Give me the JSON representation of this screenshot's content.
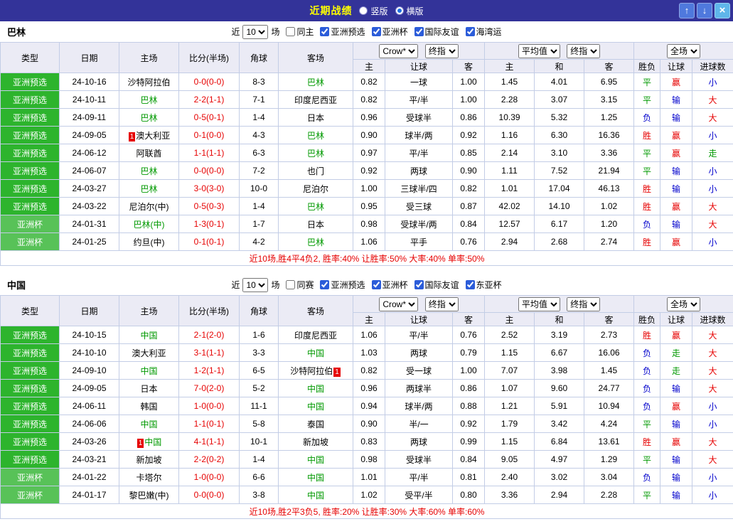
{
  "titlebar": {
    "title": "近期战绩",
    "vertical": "竖版",
    "horizontal": "横版",
    "selected": "横版",
    "up": "↑",
    "down": "↓",
    "close": "×"
  },
  "labels": {
    "near": "近",
    "games": "场"
  },
  "colors": {
    "titlebar_bg": "#333399",
    "title_text": "#ffff00",
    "badge_preliminary": "#2db42d",
    "badge_cup": "#58c25b",
    "win_red": "#e60000",
    "draw_green": "#009900",
    "lose_blue": "#0000cc",
    "focus_team_green": "#009900"
  },
  "head": {
    "type": "类型",
    "date": "日期",
    "home": "主场",
    "score": "比分(半场)",
    "corner": "角球",
    "away": "客场",
    "book": "Crow*",
    "final": "终指",
    "avg": "平均值",
    "scope": "全场",
    "sub": [
      "主",
      "让球",
      "客",
      "主",
      "和",
      "客",
      "胜负",
      "让球",
      "进球数"
    ]
  },
  "sections": [
    {
      "team": "巴林",
      "filter": {
        "count": "10",
        "same_label": "同主",
        "same_checked": false,
        "comps": [
          "亚洲预选",
          "亚洲杯",
          "国际友谊",
          "海湾运"
        ]
      },
      "rows": [
        {
          "type": "亚洲预选",
          "date": "24-10-16",
          "home": "沙特阿拉伯",
          "home_focus": false,
          "score": "0-0(0-0)",
          "corner": "8-3",
          "away": "巴林",
          "away_focus": true,
          "odds": [
            "0.82",
            "一球",
            "1.00"
          ],
          "avg": [
            "1.45",
            "4.01",
            "6.95"
          ],
          "results": [
            "平",
            "赢",
            "小"
          ]
        },
        {
          "type": "亚洲预选",
          "date": "24-10-11",
          "home": "巴林",
          "home_focus": true,
          "score": "2-2(1-1)",
          "corner": "7-1",
          "away": "印度尼西亚",
          "away_focus": false,
          "odds": [
            "0.82",
            "平/半",
            "1.00"
          ],
          "avg": [
            "2.28",
            "3.07",
            "3.15"
          ],
          "results": [
            "平",
            "输",
            "大"
          ]
        },
        {
          "type": "亚洲预选",
          "date": "24-09-11",
          "home": "巴林",
          "home_focus": true,
          "score": "0-5(0-1)",
          "corner": "1-4",
          "away": "日本",
          "away_focus": false,
          "odds": [
            "0.96",
            "受球半",
            "0.86"
          ],
          "avg": [
            "10.39",
            "5.32",
            "1.25"
          ],
          "results": [
            "负",
            "输",
            "大"
          ]
        },
        {
          "type": "亚洲预选",
          "date": "24-09-05",
          "home": "澳大利亚",
          "home_focus": false,
          "home_mark": "1",
          "home_mark_pos": "before",
          "score": "0-1(0-0)",
          "corner": "4-3",
          "away": "巴林",
          "away_focus": true,
          "odds": [
            "0.90",
            "球半/两",
            "0.92"
          ],
          "avg": [
            "1.16",
            "6.30",
            "16.36"
          ],
          "results": [
            "胜",
            "赢",
            "小"
          ]
        },
        {
          "type": "亚洲预选",
          "date": "24-06-12",
          "home": "阿联酋",
          "home_focus": false,
          "score": "1-1(1-1)",
          "corner": "6-3",
          "away": "巴林",
          "away_focus": true,
          "odds": [
            "0.97",
            "平/半",
            "0.85"
          ],
          "avg": [
            "2.14",
            "3.10",
            "3.36"
          ],
          "results": [
            "平",
            "赢",
            "走"
          ]
        },
        {
          "type": "亚洲预选",
          "date": "24-06-07",
          "home": "巴林",
          "home_focus": true,
          "score": "0-0(0-0)",
          "corner": "7-2",
          "away": "也门",
          "away_focus": false,
          "odds": [
            "0.92",
            "两球",
            "0.90"
          ],
          "avg": [
            "1.11",
            "7.52",
            "21.94"
          ],
          "results": [
            "平",
            "输",
            "小"
          ]
        },
        {
          "type": "亚洲预选",
          "date": "24-03-27",
          "home": "巴林",
          "home_focus": true,
          "score": "3-0(3-0)",
          "corner": "10-0",
          "away": "尼泊尔",
          "away_focus": false,
          "odds": [
            "1.00",
            "三球半/四",
            "0.82"
          ],
          "avg": [
            "1.01",
            "17.04",
            "46.13"
          ],
          "results": [
            "胜",
            "输",
            "小"
          ]
        },
        {
          "type": "亚洲预选",
          "date": "24-03-22",
          "home": "尼泊尔(中)",
          "home_focus": false,
          "score": "0-5(0-3)",
          "corner": "1-4",
          "away": "巴林",
          "away_focus": true,
          "odds": [
            "0.95",
            "受三球",
            "0.87"
          ],
          "avg": [
            "42.02",
            "14.10",
            "1.02"
          ],
          "results": [
            "胜",
            "赢",
            "大"
          ]
        },
        {
          "type": "亚洲杯",
          "date": "24-01-31",
          "home": "巴林(中)",
          "home_focus": true,
          "score": "1-3(0-1)",
          "corner": "1-7",
          "away": "日本",
          "away_focus": false,
          "odds": [
            "0.98",
            "受球半/两",
            "0.84"
          ],
          "avg": [
            "12.57",
            "6.17",
            "1.20"
          ],
          "results": [
            "负",
            "输",
            "大"
          ]
        },
        {
          "type": "亚洲杯",
          "date": "24-01-25",
          "home": "约旦(中)",
          "home_focus": false,
          "score": "0-1(0-1)",
          "corner": "4-2",
          "away": "巴林",
          "away_focus": true,
          "odds": [
            "1.06",
            "平手",
            "0.76"
          ],
          "avg": [
            "2.94",
            "2.68",
            "2.74"
          ],
          "results": [
            "胜",
            "赢",
            "小"
          ]
        }
      ],
      "summary": "近10场,胜4平4负2, 胜率:40% 让胜率:50% 大率:40% 单率:50%"
    },
    {
      "team": "中国",
      "filter": {
        "count": "10",
        "same_label": "同赛",
        "same_checked": false,
        "comps": [
          "亚洲预选",
          "亚洲杯",
          "国际友谊",
          "东亚杯"
        ]
      },
      "rows": [
        {
          "type": "亚洲预选",
          "date": "24-10-15",
          "home": "中国",
          "home_focus": true,
          "score": "2-1(2-0)",
          "corner": "1-6",
          "away": "印度尼西亚",
          "away_focus": false,
          "odds": [
            "1.06",
            "平/半",
            "0.76"
          ],
          "avg": [
            "2.52",
            "3.19",
            "2.73"
          ],
          "results": [
            "胜",
            "赢",
            "大"
          ]
        },
        {
          "type": "亚洲预选",
          "date": "24-10-10",
          "home": "澳大利亚",
          "home_focus": false,
          "score": "3-1(1-1)",
          "corner": "3-3",
          "away": "中国",
          "away_focus": true,
          "odds": [
            "1.03",
            "两球",
            "0.79"
          ],
          "avg": [
            "1.15",
            "6.67",
            "16.06"
          ],
          "results": [
            "负",
            "走",
            "大"
          ]
        },
        {
          "type": "亚洲预选",
          "date": "24-09-10",
          "home": "中国",
          "home_focus": true,
          "score": "1-2(1-1)",
          "corner": "6-5",
          "away": "沙特阿拉伯",
          "away_focus": false,
          "away_mark": "1",
          "away_mark_pos": "after",
          "odds": [
            "0.82",
            "受一球",
            "1.00"
          ],
          "avg": [
            "7.07",
            "3.98",
            "1.45"
          ],
          "results": [
            "负",
            "走",
            "大"
          ]
        },
        {
          "type": "亚洲预选",
          "date": "24-09-05",
          "home": "日本",
          "home_focus": false,
          "score": "7-0(2-0)",
          "corner": "5-2",
          "away": "中国",
          "away_focus": true,
          "odds": [
            "0.96",
            "两球半",
            "0.86"
          ],
          "avg": [
            "1.07",
            "9.60",
            "24.77"
          ],
          "results": [
            "负",
            "输",
            "大"
          ]
        },
        {
          "type": "亚洲预选",
          "date": "24-06-11",
          "home": "韩国",
          "home_focus": false,
          "score": "1-0(0-0)",
          "corner": "11-1",
          "away": "中国",
          "away_focus": true,
          "odds": [
            "0.94",
            "球半/两",
            "0.88"
          ],
          "avg": [
            "1.21",
            "5.91",
            "10.94"
          ],
          "results": [
            "负",
            "赢",
            "小"
          ]
        },
        {
          "type": "亚洲预选",
          "date": "24-06-06",
          "home": "中国",
          "home_focus": true,
          "score": "1-1(0-1)",
          "corner": "5-8",
          "away": "泰国",
          "away_focus": false,
          "odds": [
            "0.90",
            "半/一",
            "0.92"
          ],
          "avg": [
            "1.79",
            "3.42",
            "4.24"
          ],
          "results": [
            "平",
            "输",
            "小"
          ]
        },
        {
          "type": "亚洲预选",
          "date": "24-03-26",
          "home": "中国",
          "home_focus": true,
          "home_mark": "1",
          "home_mark_pos": "before",
          "score": "4-1(1-1)",
          "corner": "10-1",
          "away": "新加坡",
          "away_focus": false,
          "odds": [
            "0.83",
            "两球",
            "0.99"
          ],
          "avg": [
            "1.15",
            "6.84",
            "13.61"
          ],
          "results": [
            "胜",
            "赢",
            "大"
          ]
        },
        {
          "type": "亚洲预选",
          "date": "24-03-21",
          "home": "新加坡",
          "home_focus": false,
          "score": "2-2(0-2)",
          "corner": "1-4",
          "away": "中国",
          "away_focus": true,
          "odds": [
            "0.98",
            "受球半",
            "0.84"
          ],
          "avg": [
            "9.05",
            "4.97",
            "1.29"
          ],
          "results": [
            "平",
            "输",
            "大"
          ]
        },
        {
          "type": "亚洲杯",
          "date": "24-01-22",
          "home": "卡塔尔",
          "home_focus": false,
          "score": "1-0(0-0)",
          "corner": "6-6",
          "away": "中国",
          "away_focus": true,
          "odds": [
            "1.01",
            "平/半",
            "0.81"
          ],
          "avg": [
            "2.40",
            "3.02",
            "3.04"
          ],
          "results": [
            "负",
            "输",
            "小"
          ]
        },
        {
          "type": "亚洲杯",
          "date": "24-01-17",
          "home": "黎巴嫩(中)",
          "home_focus": false,
          "score": "0-0(0-0)",
          "corner": "3-8",
          "away": "中国",
          "away_focus": true,
          "odds": [
            "1.02",
            "受平/半",
            "0.80"
          ],
          "avg": [
            "3.36",
            "2.94",
            "2.28"
          ],
          "results": [
            "平",
            "输",
            "小"
          ]
        }
      ],
      "summary": "近10场,胜2平3负5, 胜率:20% 让胜率:30% 大率:60% 单率:60%"
    }
  ]
}
